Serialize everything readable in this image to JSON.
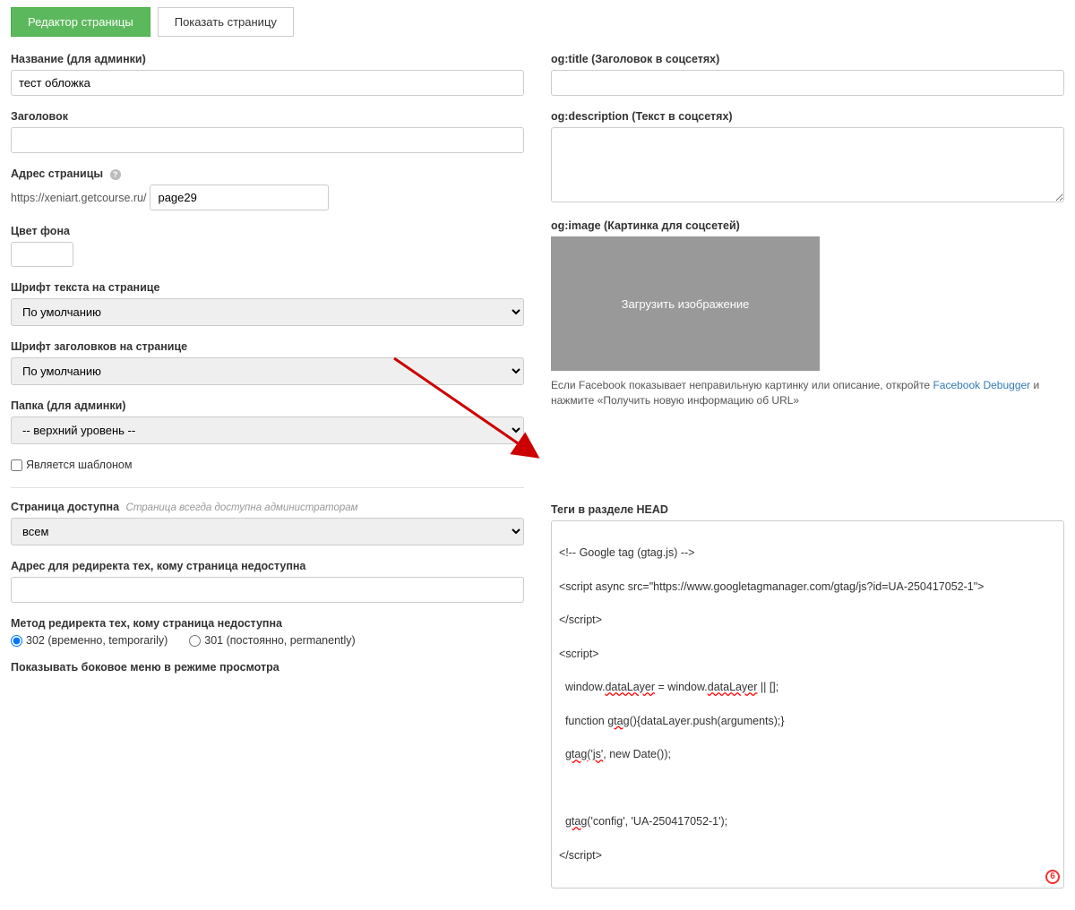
{
  "tabs": {
    "editor": "Редактор страницы",
    "show": "Показать страницу"
  },
  "left": {
    "name_label": "Название (для админки)",
    "name_value": "тест обложка",
    "title_label": "Заголовок",
    "title_value": "",
    "url_label": "Адрес страницы",
    "url_prefix": "https://xeniart.getcourse.ru/",
    "url_value": "page29",
    "bgcolor_label": "Цвет фона",
    "textfont_label": "Шрифт текста на странице",
    "textfont_value": "По умолчанию",
    "headfont_label": "Шрифт заголовков на странице",
    "headfont_value": "По умолчанию",
    "folder_label": "Папка (для админки)",
    "folder_value": "-- верхний уровень --",
    "template_label": "Является шаблоном",
    "access_label": "Страница доступна",
    "access_note": "Страница всегда доступна администраторам",
    "access_value": "всем",
    "redirect_label": "Адрес для редиректа тех, кому страница недоступна",
    "redirect_value": "",
    "redirectmethod_label": "Метод редиректа тех, кому страница недоступна",
    "redirect302": "302 (временно, temporarily)",
    "redirect301": "301 (постоянно, permanently)",
    "sidemenu_label": "Показывать боковое меню в режиме просмотра"
  },
  "right": {
    "ogtitle_label": "og:title (Заголовок в соцсетях)",
    "ogtitle_value": "",
    "ogdesc_label": "og:description (Текст в соцсетях)",
    "ogdesc_value": "",
    "ogimage_label": "og:image (Картинка для соцсетей)",
    "ogimage_btn": "Загрузить изображение",
    "fb_note_pre": "Если Facebook показывает неправильную картинку или описание, откройте ",
    "fb_note_link": "Facebook Debugger",
    "fb_note_post": " и нажмите «Получить новую информацию об URL»",
    "headtags_label": "Теги в разделе HEAD",
    "headtags": {
      "l1": "<!-- Google tag (gtag.js) -->",
      "l2a": "<script async src=\"https://www.googletagmanager.com/gtag/js?id",
      "l2b": "UA-250417052-1\">",
      "l3": "</script>",
      "l4": "<script>",
      "l5a": "  window.",
      "l5b": "dataLayer",
      "l5c": " = window.",
      "l5d": "dataLayer",
      "l5e": " || [];",
      "l6a": "  function ",
      "l6b": "gtag",
      "l6c": "(){dataLayer.push(arguments);}",
      "l7a": "  ",
      "l7b": "gtag('js'",
      "l7c": ", new Date());",
      "l8": "",
      "l9a": "  ",
      "l9b": "gtag",
      "l9c": "('config', 'UA-250417052-1');",
      "l10a": "</script>",
      "l10b": ""
    },
    "badge": "6"
  }
}
